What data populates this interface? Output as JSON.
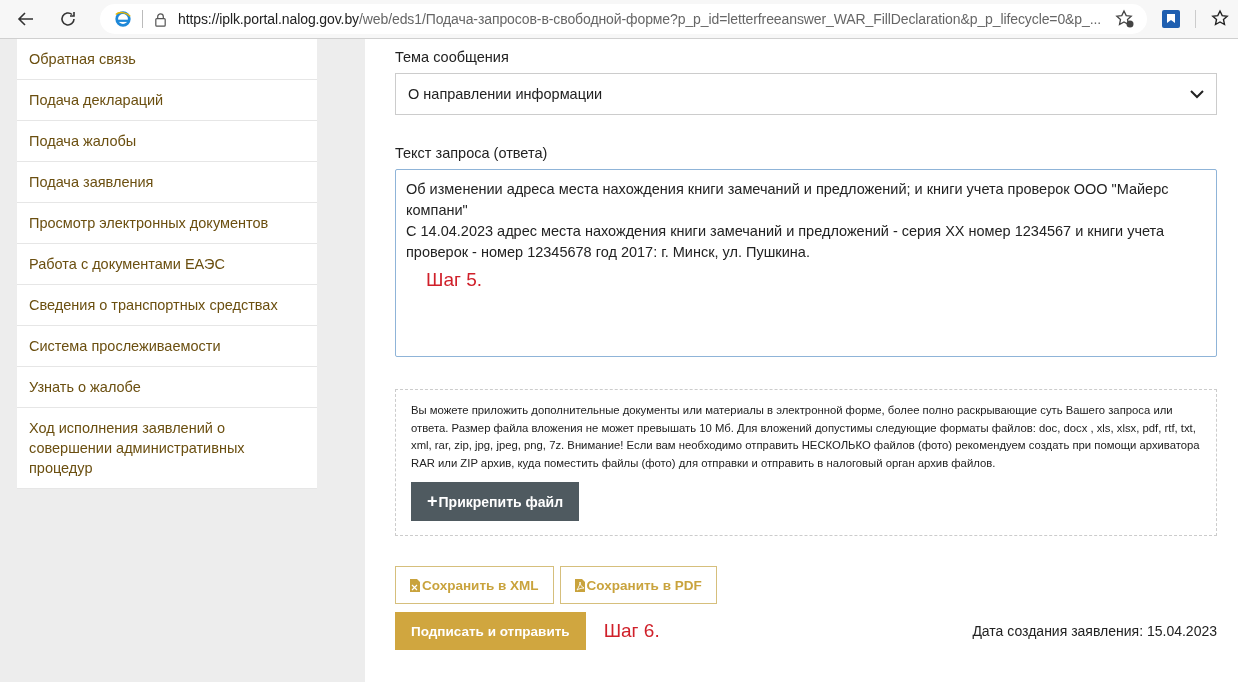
{
  "browser": {
    "url_host": "https://iplk.portal.nalog.gov.by",
    "url_path": "/web/eds1/Подача-запросов-в-свободной-форме?p_p_id=letterfreeanswer_WAR_FillDeclaration&p_p_lifecycle=0&p_..."
  },
  "sidebar": {
    "items": [
      {
        "label": "Обратная связь"
      },
      {
        "label": "Подача деклараций"
      },
      {
        "label": "Подача жалобы"
      },
      {
        "label": "Подача заявления"
      },
      {
        "label": "Просмотр электронных документов"
      },
      {
        "label": "Работа с документами ЕАЭС"
      },
      {
        "label": "Сведения о транспортных средствах"
      },
      {
        "label": "Система прослеживаемости"
      },
      {
        "label": "Узнать о жалобе"
      },
      {
        "label": "Ход исполнения заявлений о совершении административных процедур"
      }
    ]
  },
  "form": {
    "subject_label": "Тема сообщения",
    "subject_value": "О направлении информации",
    "text_label": "Текст запроса (ответа)",
    "text_value": "Об изменении адреса места нахождения книги замечаний и предложений; и книги учета проверок ООО \"Майерс компани\"\nС 14.04.2023 адрес места нахождения книги замечаний и предложений - серия XX номер 1234567 и книги учета проверок - номер 12345678 год 2017: г. Минск, ул. Пушкина.",
    "step_note_1": "Шаг 5.",
    "attach_info": "Вы можете приложить дополнительные документы или материалы в электронной форме, более полно раскрывающие суть Вашего запроса или ответа. Размер файла вложения не может превышать 10 Мб. Для вложений допустимы следующие форматы файлов: doc, docx , xls, xlsx, pdf, rtf, txt, xml, rar, zip, jpg, jpeg, png, 7z. Внимание! Если вам необходимо отправить НЕСКОЛЬКО файлов (фото) рекомендуем создать при помощи архиватора RAR или ZIP архив, куда поместить файлы (фото) для отправки и отправить в налоговый орган архив файлов.",
    "attach_button": "Прикрепить файл",
    "attach_button_icon": "+",
    "save_buttons": [
      {
        "kind": "xml",
        "label": "Сохранить в XML"
      },
      {
        "kind": "pdf",
        "label": "Сохранить в PDF"
      }
    ],
    "submit_button": "Подписать и отправить",
    "step_note_2": "Шаг 6.",
    "created_date": "Дата создания заявления: 15.04.2023"
  }
}
